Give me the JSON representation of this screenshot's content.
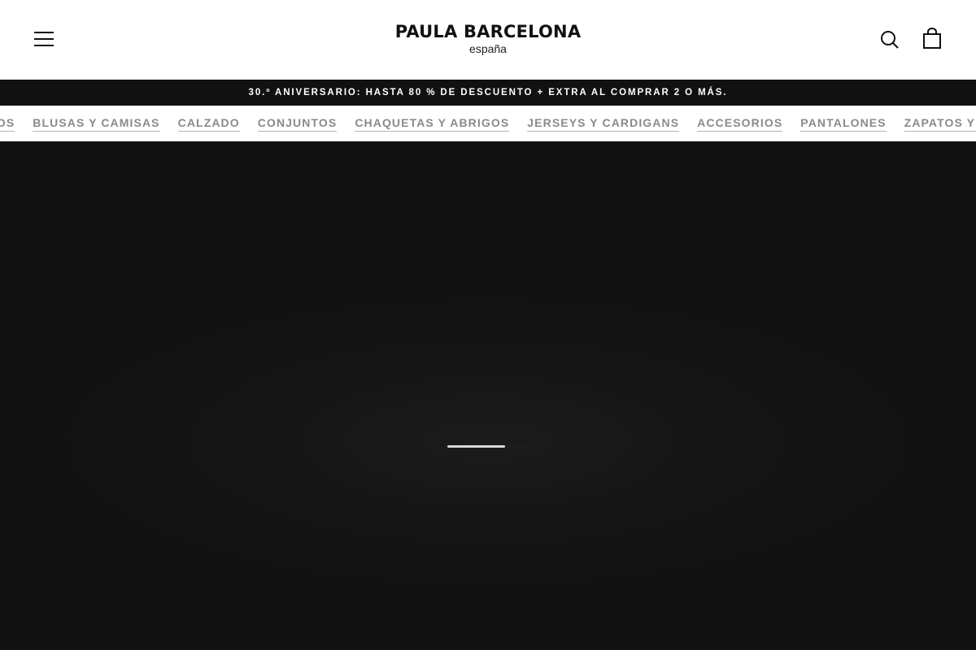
{
  "header": {
    "brand": "PAULA BARCELONA",
    "region": "españa",
    "menu_icon": "hamburger-menu-icon",
    "search_icon": "search-icon",
    "cart_icon": "shopping-bag-icon"
  },
  "announcement": {
    "text": "30.º ANIVERSARIO: HASTA 80 % DE DESCUENTO + EXTRA AL COMPRAR 2 O MÁS."
  },
  "categories": [
    "TIDOS",
    "BLUSAS Y CAMISAS",
    "CALZADO",
    "CONJUNTOS",
    "CHAQUETAS Y ABRIGOS",
    "JERSEYS Y CARDIGANS",
    "ACCESORIOS",
    "PANTALONES",
    "ZAPATOS Y BO"
  ],
  "hero": {
    "loader_progress": 0.71
  },
  "colors": {
    "header_bg": "#ffffff",
    "announcement_bg": "#111111",
    "hero_bg": "#111111",
    "category_text": "#8a8a8a"
  }
}
